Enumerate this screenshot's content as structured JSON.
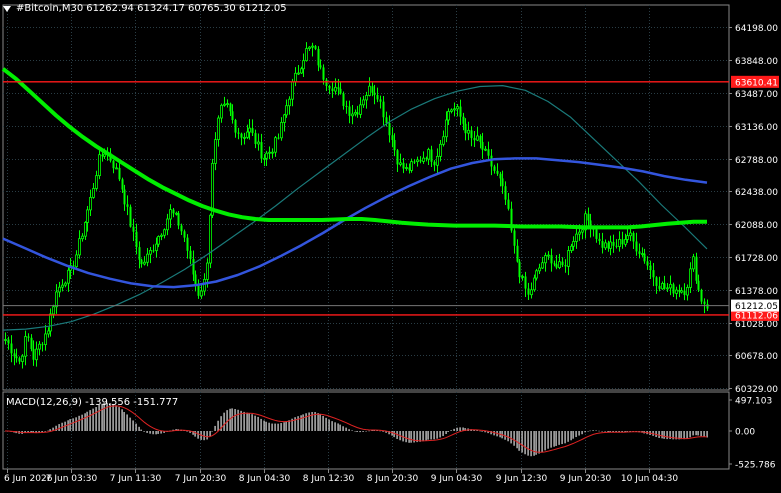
{
  "header": {
    "symbol": "#Bitcoin,M30",
    "ohlc": "61262.94 61324.17 60765.30 61212.05"
  },
  "macd": {
    "label": "MACD(12,26,9)",
    "values": "-139.556 -151.777"
  },
  "colors": {
    "background": "#000000",
    "candle": "#00ff00",
    "grid": "#2a3d45",
    "hline": "#ff1a1a",
    "ma_slow": "#00ee00",
    "ma_mid": "#3355dd",
    "ma_fast": "#1a7a7a",
    "macd_hist": "#c0c0c0",
    "macd_signal": "#dd2222"
  },
  "chart_data": {
    "type": "candlestick",
    "symbol": "#Bitcoin",
    "timeframe": "M30",
    "price_axis": [
      "64198.00",
      "63848.00",
      "63487.00",
      "63136.00",
      "62788.00",
      "62438.00",
      "62088.00",
      "61728.00",
      "61378.00",
      "61028.00",
      "60678.00",
      "60329.00"
    ],
    "price_levels": [
      64198,
      63848,
      63487,
      63136,
      62788,
      62438,
      62088,
      61728,
      61378,
      61028,
      60678,
      60329
    ],
    "horizontal_lines": [
      {
        "price": 63610.41,
        "label": "63610.41"
      },
      {
        "price": 61112.06,
        "label": "61112.06"
      }
    ],
    "current_price": {
      "price": 61212.05,
      "label": "61212.05"
    },
    "time_axis": [
      "6 Jun 2026",
      "7 Jun 03:30",
      "7 Jun 11:30",
      "7 Jun 20:30",
      "8 Jun 04:30",
      "8 Jun 12:30",
      "8 Jun 20:30",
      "9 Jun 04:30",
      "9 Jun 12:30",
      "9 Jun 20:30",
      "10 Jun 04:30"
    ],
    "ylim": [
      60329,
      64198
    ],
    "close_path": [
      60850,
      60720,
      60610,
      60900,
      60650,
      60820,
      60980,
      61330,
      61480,
      61560,
      61780,
      62080,
      62380,
      62760,
      62880,
      62740,
      62560,
      62240,
      61910,
      61640,
      61750,
      61900,
      62040,
      62220,
      62130,
      61940,
      61600,
      61340,
      61500,
      62750,
      63300,
      63350,
      63140,
      63020,
      63110,
      62960,
      62800,
      62870,
      62990,
      63280,
      63560,
      63760,
      63940,
      63980,
      63730,
      63600,
      63550,
      63420,
      63300,
      63280,
      63450,
      63550,
      63480,
      63220,
      62980,
      62720,
      62660,
      62720,
      62790,
      62850,
      62760,
      63050,
      63330,
      63310,
      63150,
      62990,
      62980,
      62840,
      62690,
      62550,
      62300,
      61820,
      61510,
      61310,
      61520,
      61680,
      61740,
      61620,
      61630,
      61900,
      62000,
      62150,
      62070,
      61870,
      61850,
      61840,
      61900,
      61980,
      61850,
      61760,
      61600,
      61460,
      61400,
      61390,
      61390,
      61380,
      61700,
      61300,
      61212
    ],
    "ma_slow": [
      63750,
      63640,
      63510,
      63380,
      63250,
      63130,
      63020,
      62920,
      62830,
      62740,
      62650,
      62560,
      62480,
      62410,
      62340,
      62280,
      62230,
      62190,
      62160,
      62140,
      62130,
      62130,
      62130,
      62130,
      62130,
      62135,
      62140,
      62140,
      62130,
      62115,
      62100,
      62090,
      62080,
      62075,
      62070,
      62070,
      62070,
      62070,
      62065,
      62060,
      62060,
      62060,
      62060,
      62055,
      62050,
      62050,
      62050,
      62050,
      62060,
      62075,
      62090,
      62100,
      62110,
      62110
    ],
    "ma_mid": [
      61930,
      61830,
      61730,
      61640,
      61560,
      61500,
      61450,
      61420,
      61410,
      61430,
      61470,
      61540,
      61630,
      61740,
      61860,
      61990,
      62130,
      62260,
      62380,
      62490,
      62590,
      62680,
      62740,
      62780,
      62790,
      62790,
      62770,
      62750,
      62720,
      62690,
      62650,
      62600,
      62560,
      62530
    ],
    "ma_fast": [
      60950,
      60960,
      60990,
      61040,
      61120,
      61220,
      61330,
      61460,
      61600,
      61760,
      61930,
      62100,
      62280,
      62470,
      62650,
      62830,
      63010,
      63180,
      63320,
      63430,
      63510,
      63560,
      63570,
      63520,
      63400,
      63230,
      63000,
      62770,
      62540,
      62290,
      62060,
      61820
    ]
  }
}
